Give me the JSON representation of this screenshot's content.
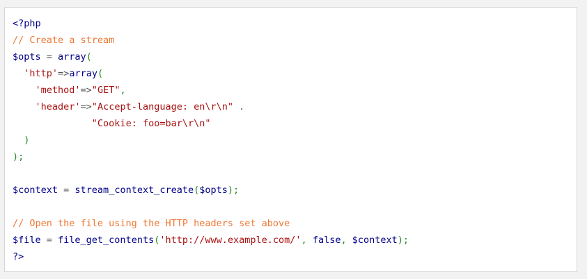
{
  "code": {
    "language": "php",
    "colors": {
      "meta": "#000088",
      "comment": "#ee7733",
      "variable": "#000088",
      "operator": "#555555",
      "function": "#000088",
      "punctuation": "#228822",
      "string": "#aa1111",
      "keyword": "#000088"
    },
    "lines": [
      [
        {
          "t": "meta",
          "v": "<?php"
        }
      ],
      [
        {
          "t": "comment",
          "v": "// Create a stream"
        }
      ],
      [
        {
          "t": "var",
          "v": "$opts"
        },
        {
          "t": "op",
          "v": " = "
        },
        {
          "t": "func",
          "v": "array"
        },
        {
          "t": "punct",
          "v": "("
        }
      ],
      [
        {
          "t": "plain",
          "v": "  "
        },
        {
          "t": "string",
          "v": "'http'"
        },
        {
          "t": "op",
          "v": "=>"
        },
        {
          "t": "func",
          "v": "array"
        },
        {
          "t": "punct",
          "v": "("
        }
      ],
      [
        {
          "t": "plain",
          "v": "    "
        },
        {
          "t": "string",
          "v": "'method'"
        },
        {
          "t": "op",
          "v": "=>"
        },
        {
          "t": "string",
          "v": "\"GET\""
        },
        {
          "t": "punct",
          "v": ","
        }
      ],
      [
        {
          "t": "plain",
          "v": "    "
        },
        {
          "t": "string",
          "v": "'header'"
        },
        {
          "t": "op",
          "v": "=>"
        },
        {
          "t": "string",
          "v": "\"Accept-language: en\\r\\n\""
        },
        {
          "t": "op",
          "v": " ."
        }
      ],
      [
        {
          "t": "plain",
          "v": "              "
        },
        {
          "t": "string",
          "v": "\"Cookie: foo=bar\\r\\n\""
        }
      ],
      [
        {
          "t": "plain",
          "v": "  "
        },
        {
          "t": "punct",
          "v": ")"
        }
      ],
      [
        {
          "t": "punct",
          "v": ");"
        }
      ],
      [],
      [
        {
          "t": "var",
          "v": "$context"
        },
        {
          "t": "op",
          "v": " = "
        },
        {
          "t": "func",
          "v": "stream_context_create"
        },
        {
          "t": "punct",
          "v": "("
        },
        {
          "t": "var",
          "v": "$opts"
        },
        {
          "t": "punct",
          "v": ");"
        }
      ],
      [],
      [
        {
          "t": "comment",
          "v": "// Open the file using the HTTP headers set above"
        }
      ],
      [
        {
          "t": "var",
          "v": "$file"
        },
        {
          "t": "op",
          "v": " = "
        },
        {
          "t": "func",
          "v": "file_get_contents"
        },
        {
          "t": "punct",
          "v": "("
        },
        {
          "t": "string",
          "v": "'http://www.example.com/'"
        },
        {
          "t": "punct",
          "v": ", "
        },
        {
          "t": "keyword",
          "v": "false"
        },
        {
          "t": "punct",
          "v": ", "
        },
        {
          "t": "var",
          "v": "$context"
        },
        {
          "t": "punct",
          "v": ");"
        }
      ],
      [
        {
          "t": "meta",
          "v": "?>"
        }
      ]
    ]
  }
}
